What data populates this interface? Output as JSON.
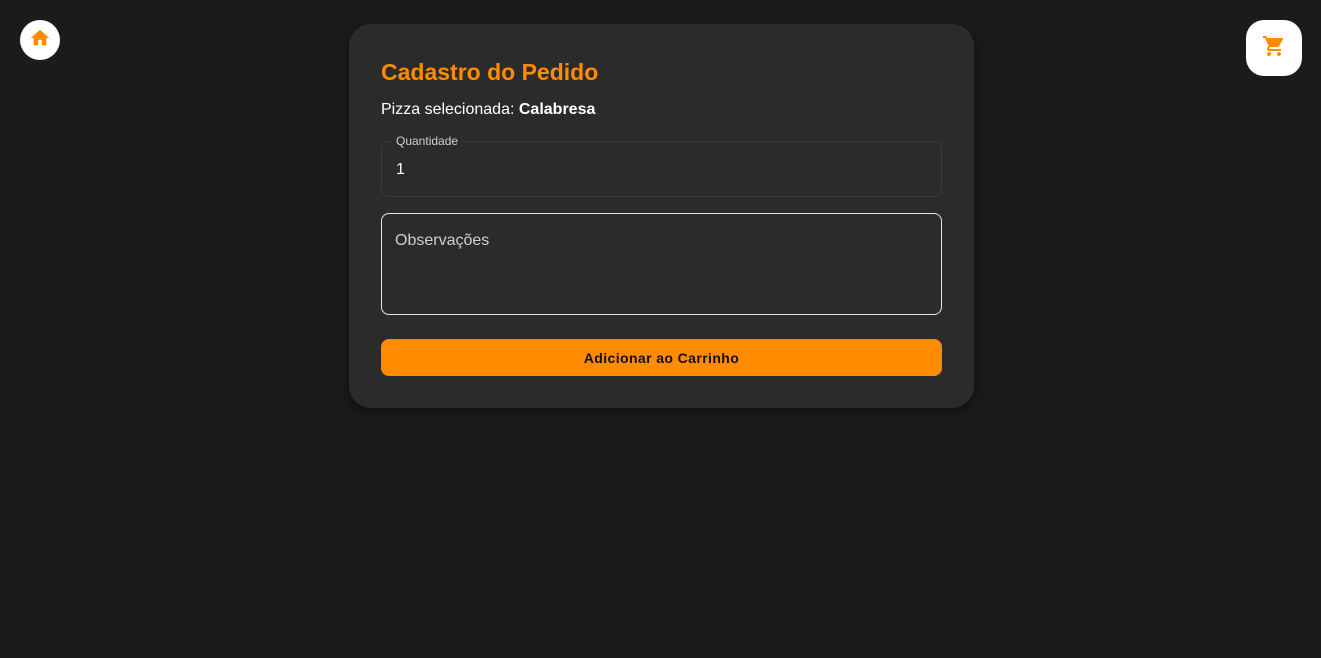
{
  "nav": {
    "home_icon": "home-icon",
    "cart_icon": "shopping-cart-icon"
  },
  "form": {
    "title": "Cadastro do Pedido",
    "selected_prefix": "Pizza selecionada:",
    "selected_pizza": "Calabresa",
    "quantity_label": "Quantidade",
    "quantity_value": "1",
    "observations_placeholder": "Observações",
    "submit_label": "Adicionar ao Carrinho"
  },
  "colors": {
    "background": "#1b1b1b",
    "card": "#2b2b2b",
    "accent": "#ff8c00"
  }
}
